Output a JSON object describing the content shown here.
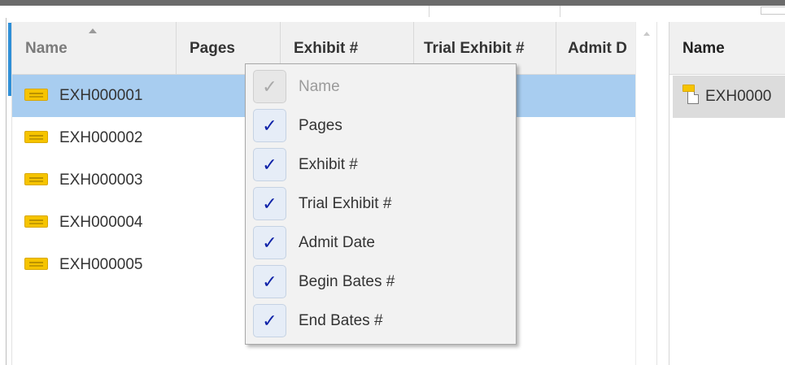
{
  "grid": {
    "columns": [
      {
        "label": "Name",
        "sorted": "ascending"
      },
      {
        "label": "Pages"
      },
      {
        "label": "Exhibit #"
      },
      {
        "label": "Trial Exhibit #"
      },
      {
        "label": "Admit D"
      }
    ],
    "rows": [
      {
        "name": "EXH000001",
        "selected": true,
        "icon": "exhibit-tag-icon"
      },
      {
        "name": "EXH000002",
        "selected": false,
        "icon": "exhibit-tag-icon"
      },
      {
        "name": "EXH000003",
        "selected": false,
        "icon": "exhibit-tag-icon"
      },
      {
        "name": "EXH000004",
        "selected": false,
        "icon": "exhibit-tag-icon"
      },
      {
        "name": "EXH000005",
        "selected": false,
        "icon": "exhibit-tag-icon"
      }
    ]
  },
  "column_menu": {
    "items": [
      {
        "label": "Name",
        "checked": true,
        "enabled": false
      },
      {
        "label": "Pages",
        "checked": true,
        "enabled": true
      },
      {
        "label": "Exhibit #",
        "checked": true,
        "enabled": true
      },
      {
        "label": "Trial Exhibit #",
        "checked": true,
        "enabled": true
      },
      {
        "label": "Admit Date",
        "checked": true,
        "enabled": true
      },
      {
        "label": "Begin Bates #",
        "checked": true,
        "enabled": true
      },
      {
        "label": "End Bates #",
        "checked": true,
        "enabled": true
      }
    ],
    "check_glyph": "✓"
  },
  "detail_pane": {
    "header": "Name",
    "row_label": "EXH0000",
    "row_icon": "exhibit-document-icon"
  },
  "colors": {
    "selection": "#a8cdf0",
    "accent": "#2f8fd7",
    "check": "#0f22a8",
    "exhibit_tag": "#f6c400"
  }
}
